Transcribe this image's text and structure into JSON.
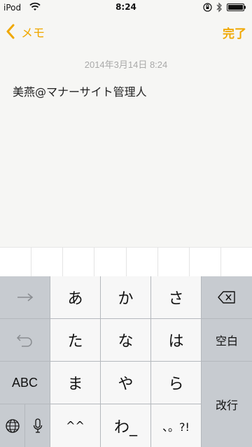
{
  "status_bar": {
    "carrier": "iPod",
    "time": "8:24",
    "icons": [
      "wifi-icon",
      "orientation-lock-icon",
      "bluetooth-icon",
      "battery-icon"
    ]
  },
  "nav": {
    "back_label": "メモ",
    "done_label": "完了"
  },
  "note": {
    "date": "2014年3月14日 8:24",
    "text": "美燕@マナーサイト管理人"
  },
  "prediction_bar": {
    "cells": 8
  },
  "keyboard": {
    "rows": [
      [
        "→",
        "あ",
        "か",
        "さ",
        "delete"
      ],
      [
        "undo",
        "た",
        "な",
        "は",
        "空白"
      ],
      [
        "ABC",
        "ま",
        "や",
        "ら",
        "改行"
      ],
      [
        "globe",
        "mic",
        "^^",
        "わ_",
        "、。?!"
      ]
    ],
    "labels": {
      "a": "あ",
      "ka": "か",
      "sa": "さ",
      "ta": "た",
      "na": "な",
      "ha": "は",
      "ma": "ま",
      "ya": "や",
      "ra": "ら",
      "kao": "^^",
      "wa": "わ_",
      "punct": "、。?!",
      "abc": "ABC",
      "space": "空白",
      "return": "改行"
    }
  },
  "colors": {
    "accent": "#f0a800",
    "keyboard_bg": "#c9cdd2",
    "key_light": "#f7f7f7",
    "key_dark": "#c7cbd0"
  }
}
